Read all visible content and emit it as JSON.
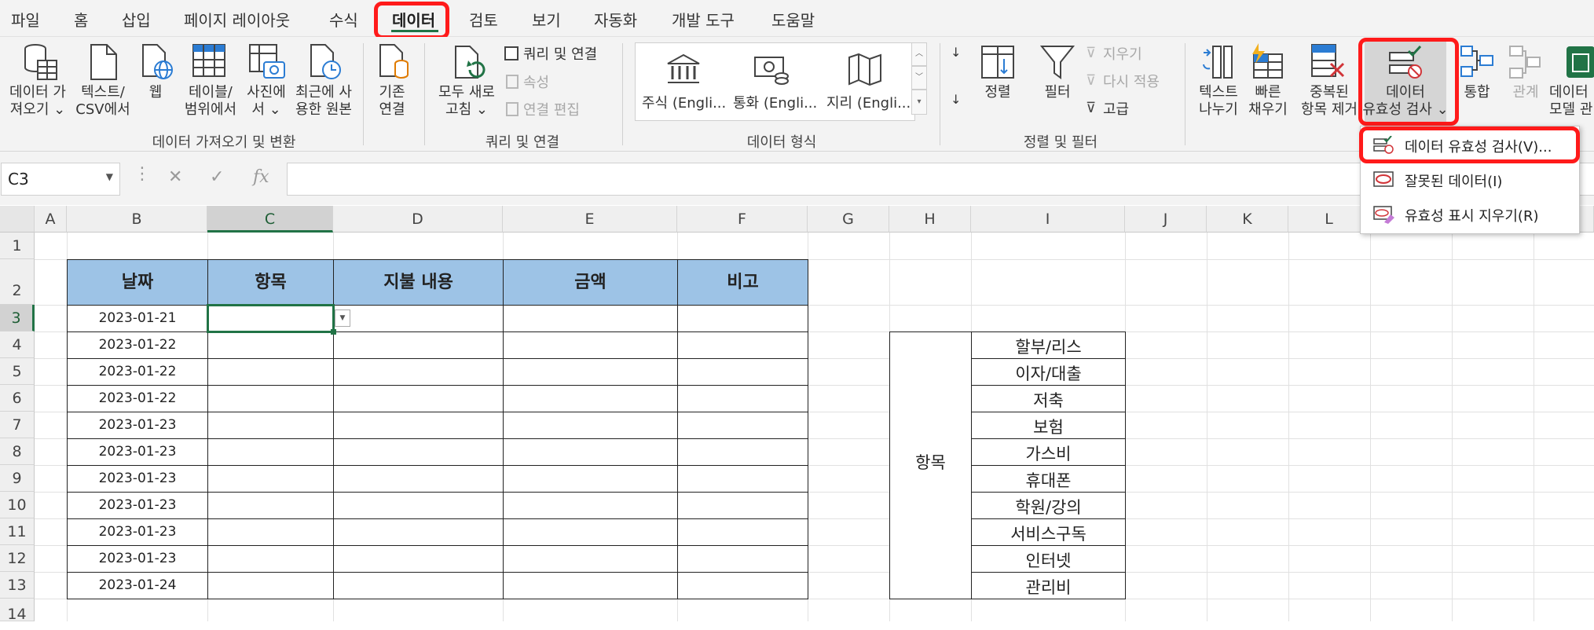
{
  "tabs": [
    "파일",
    "홈",
    "삽입",
    "페이지 레이아웃",
    "수식",
    "데이터",
    "검토",
    "보기",
    "자동화",
    "개발 도구",
    "도움말"
  ],
  "active_tab": "데이터",
  "ribbon": {
    "get_data": [
      "데이터 가",
      "져오기 ⌄"
    ],
    "text_csv": [
      "텍스트/",
      "CSV에서"
    ],
    "web": "웹",
    "table_range": [
      "테이블/",
      "범위에서"
    ],
    "from_picture": [
      "사진에",
      "서 ⌄"
    ],
    "recent_sources": [
      "최근에 사",
      "용한 원본"
    ],
    "existing_conn": [
      "기존",
      "연결"
    ],
    "group_get_transform": "데이터 가져오기 및 변환",
    "refresh_all": [
      "모두 새로",
      "고침 ⌄"
    ],
    "queries_conn": "쿼리 및 연결",
    "properties": "속성",
    "edit_links": "연결 편집",
    "group_queries": "쿼리 및 연결",
    "dt_stocks": "주식 (Engli...",
    "dt_currency": "통화 (Engli...",
    "dt_geo": "지리 (Engli...",
    "group_data_types": "데이터 형식",
    "sort": "정렬",
    "filter": "필터",
    "clear": "지우기",
    "reapply": "다시 적용",
    "advanced": "고급",
    "group_sort_filter": "정렬 및 필터",
    "text_to_columns": [
      "텍스트",
      "나누기"
    ],
    "flash_fill": [
      "빠른",
      "채우기"
    ],
    "remove_dupes": [
      "중복된",
      "항목 제거"
    ],
    "data_validation": [
      "데이터",
      "유효성 검사 ⌄"
    ],
    "consolidate": "통합",
    "relationships": "관계",
    "data_model": [
      "데이터",
      "모델 관"
    ]
  },
  "formula_bar": {
    "name_box": "C3",
    "fx": "fx",
    "cancel": "✕",
    "enter": "✓",
    "value": ""
  },
  "columns": [
    "A",
    "B",
    "C",
    "D",
    "E",
    "F",
    "G",
    "H",
    "I",
    "J",
    "K",
    "L"
  ],
  "rows": [
    "1",
    "2",
    "3",
    "4",
    "5",
    "6",
    "7",
    "8",
    "9",
    "10",
    "11",
    "12",
    "13",
    "14"
  ],
  "table": {
    "headers": [
      "날짜",
      "항목",
      "지불 내용",
      "금액",
      "비고"
    ],
    "dates": [
      "2023-01-21",
      "2023-01-22",
      "2023-01-22",
      "2023-01-22",
      "2023-01-23",
      "2023-01-23",
      "2023-01-23",
      "2023-01-23",
      "2023-01-23",
      "2023-01-23",
      "2023-01-24"
    ]
  },
  "category_list": {
    "label": "항목",
    "items": [
      "할부/리스",
      "이자/대출",
      "저축",
      "보험",
      "가스비",
      "휴대폰",
      "학원/강의",
      "서비스구독",
      "인터넷",
      "관리비"
    ]
  },
  "dropdown_menu": [
    {
      "label": "데이터 유효성 검사(V)...",
      "icon": "data-validation-icon"
    },
    {
      "label": "잘못된 데이터(I)",
      "icon": "circle-invalid-icon"
    },
    {
      "label": "유효성 표시 지우기(R)",
      "icon": "clear-circles-icon"
    }
  ],
  "accent_colors": {
    "excel_green": "#217346",
    "header_fill": "#9dc3e6",
    "highlight_red": "#ff1a1a"
  }
}
